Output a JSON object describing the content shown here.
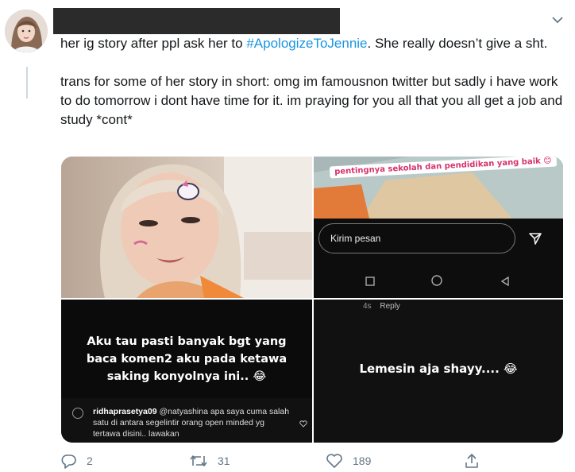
{
  "tweet": {
    "line1_before": "her ig story after ppl ask her to ",
    "hashtag": "#ApologizeToJennie",
    "line1_after": ". She really doesn’t give a sht.",
    "line2": "trans for some of her story in short: omg im famousnon twitter but sadly  i have work to do tomorrow i dont have time for it. im praying for you all that you all get a job and study *cont*"
  },
  "media": {
    "tile2": {
      "banner": "pentingnya sekolah dan pendidikan yang baik 😊",
      "input_placeholder": "Kirim pesan"
    },
    "tile3": {
      "story_line1": "Aku tau pasti banyak bgt yang",
      "story_line2": "baca komen2 aku pada ketawa",
      "story_line3": "saking konyolnya ini.. 😂",
      "comment_user": "ridhaprasetya09",
      "comment_text": "@natyashina apa saya cuma salah satu di antara segelintir orang open minded yg tertawa disini.. lawakan"
    },
    "tile4": {
      "time": "4s",
      "reply": "Reply",
      "story_text": "Lemesin aja shayy.... 😂"
    }
  },
  "actions": {
    "replies": "2",
    "retweets": "31",
    "likes": "189"
  },
  "colors": {
    "hashtag": "#1b95e0",
    "icon": "#657786"
  }
}
